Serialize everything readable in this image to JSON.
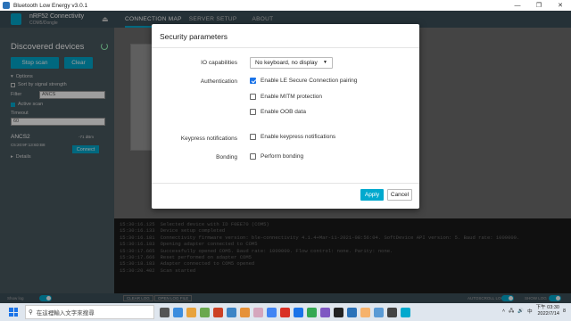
{
  "window": {
    "title": "Bluetooth Low Energy v3.0.1",
    "controls": [
      "—",
      "❐",
      "✕"
    ]
  },
  "header": {
    "device_name": "nRF52 Connectivity",
    "device_port": "COM5/Dongle",
    "tabs": [
      "CONNECTION MAP",
      "SERVER SETUP",
      "ABOUT"
    ]
  },
  "sidebar": {
    "title": "Discovered devices",
    "stop_scan": "Stop scan",
    "clear": "Clear",
    "options": "Options",
    "sort_by_signal": "Sort by signal strength",
    "filter_label": "Filter",
    "filter_value": "ANCS",
    "active_scan": "Active scan",
    "timeout_label": "Timeout",
    "timeout_value": "60",
    "device": {
      "name": "ANCS2",
      "address": "C5:20:9F:13:6D:B8",
      "rssi": "-71 dBm"
    },
    "connect": "Connect",
    "details": "Details"
  },
  "modal": {
    "title": "Security parameters",
    "io_label": "IO capabilities",
    "io_value": "No keyboard, no display",
    "auth_label": "Authentication",
    "auth_options": [
      {
        "label": "Enable LE Secure Connection pairing",
        "checked": true
      },
      {
        "label": "Enable MITM protection",
        "checked": false
      },
      {
        "label": "Enable OOB data",
        "checked": false
      }
    ],
    "keypress_label": "Keypress notifications",
    "keypress_option": "Enable keypress notifications",
    "bonding_label": "Bonding",
    "bonding_option": "Perform bonding",
    "apply": "Apply",
    "cancel": "Cancel"
  },
  "log": [
    {
      "time": "15:30:16.125",
      "text": "Selected device with ID F0EE70 (COM5)"
    },
    {
      "time": "15:30:16.133",
      "text": "Device setup completed"
    },
    {
      "time": "15:30:16.181",
      "text": "Connectivity firmware version: ble-connectivity 4.1.4+Mar-11-2021-08:56:04. SoftDevice API version: 5. Baud rate: 1000000."
    },
    {
      "time": "15:30:16.183",
      "text": "Opening adapter connected to COM5"
    },
    {
      "time": "15:30:17.665",
      "text": "Successfully opened COM5. Baud rate: 1000000. Flow control: none. Parity: none."
    },
    {
      "time": "15:30:17.666",
      "text": "Reset performed on adapter COM5"
    },
    {
      "time": "15:30:18.183",
      "text": "Adapter connected to COM5 opened"
    },
    {
      "time": "15:30:20.402",
      "text": "Scan started"
    }
  ],
  "bottombar": {
    "auto_scroll_left": "Show log",
    "clear_logs": "CLEAR LOG",
    "open_log_file": "OPEN LOG FILE",
    "autoscroll": "AUTOSCROLL LOG",
    "show_log": "SHOW LOG"
  },
  "taskbar": {
    "search_placeholder": "在這裡輸入文字來搜尋",
    "time": "下午 03:30",
    "date": "2022/7/14",
    "ime": "中",
    "notif": "8"
  },
  "colors": {
    "accent": "#00a9ce",
    "header": "#3d4f5a",
    "sidebar": "#4a5960"
  }
}
